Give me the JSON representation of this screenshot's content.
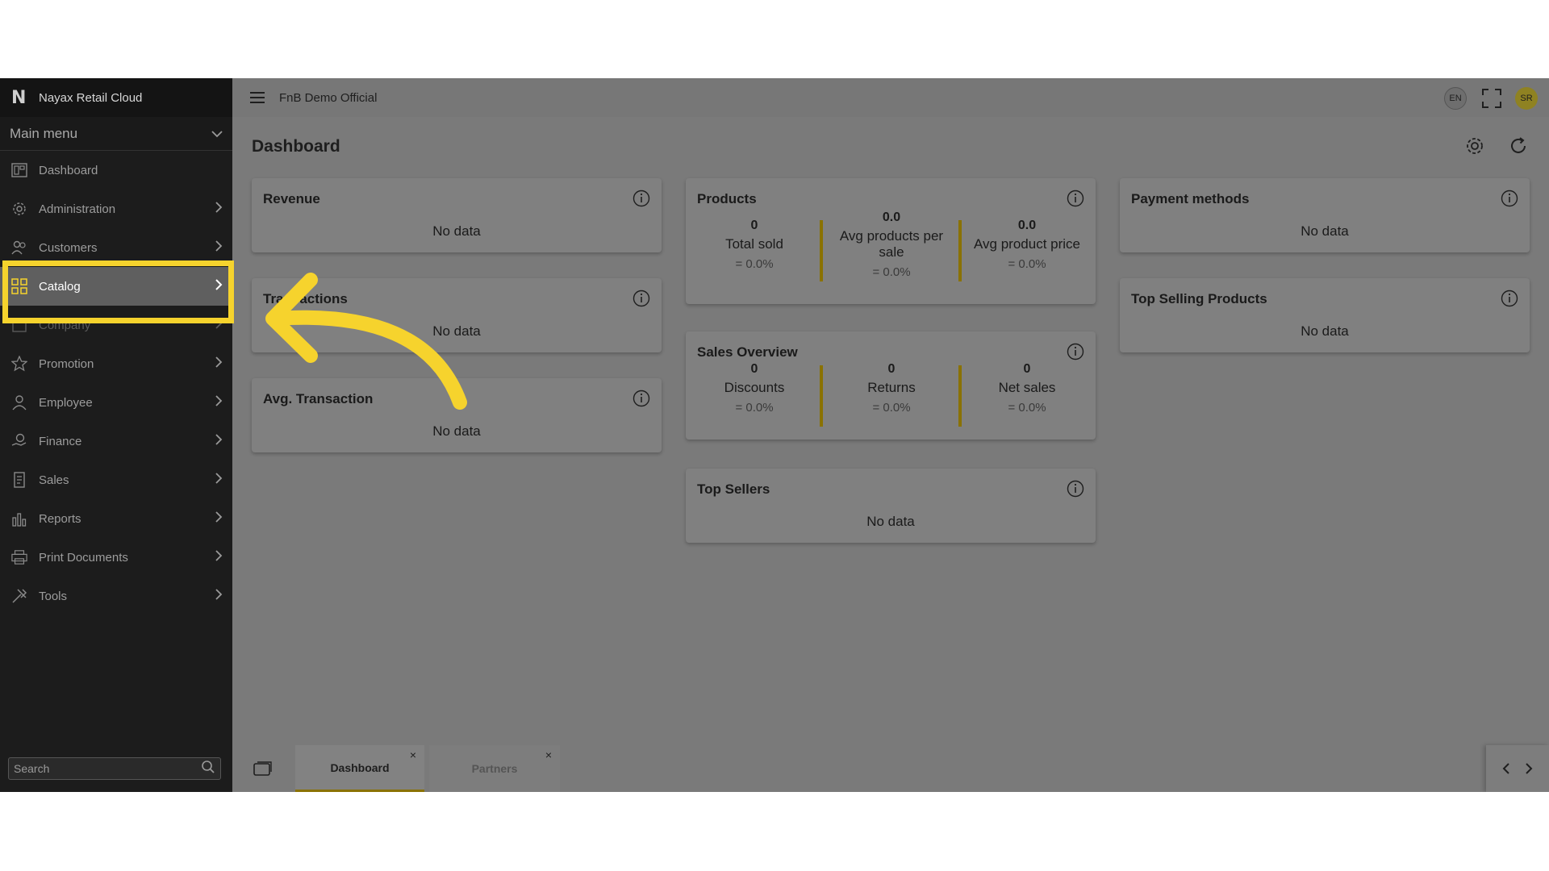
{
  "brand": {
    "name": "Nayax Retail Cloud",
    "logo_letter": "N"
  },
  "sidebar": {
    "section_label": "Main menu",
    "items": [
      {
        "label": "Dashboard",
        "icon": "dashboard-icon",
        "chevron": false
      },
      {
        "label": "Administration",
        "icon": "gear-person-icon",
        "chevron": true
      },
      {
        "label": "Customers",
        "icon": "customers-icon",
        "chevron": true
      },
      {
        "label": "Catalog",
        "icon": "grid-icon",
        "chevron": true,
        "active": true
      },
      {
        "label": "Company",
        "icon": "building-icon",
        "chevron": true
      },
      {
        "label": "Promotion",
        "icon": "star-icon",
        "chevron": true
      },
      {
        "label": "Employee",
        "icon": "employee-icon",
        "chevron": true
      },
      {
        "label": "Finance",
        "icon": "finance-icon",
        "chevron": true
      },
      {
        "label": "Sales",
        "icon": "sales-icon",
        "chevron": true
      },
      {
        "label": "Reports",
        "icon": "bar-chart-icon",
        "chevron": true
      },
      {
        "label": "Print Documents",
        "icon": "printer-icon",
        "chevron": true
      },
      {
        "label": "Tools",
        "icon": "tools-icon",
        "chevron": true
      }
    ],
    "search_placeholder": "Search"
  },
  "topbar": {
    "org_name": "FnB Demo Official",
    "language": "EN",
    "avatar_initials": "SR"
  },
  "page": {
    "title": "Dashboard"
  },
  "cards": {
    "revenue": {
      "title": "Revenue",
      "empty": "No data"
    },
    "transactions": {
      "title": "Transactions",
      "empty": "No data"
    },
    "avg_transaction": {
      "title": "Avg. Transaction",
      "empty": "No data"
    },
    "products": {
      "title": "Products",
      "metrics": [
        {
          "value": "0",
          "label": "Total sold",
          "change": "= 0.0%"
        },
        {
          "value": "0.0",
          "label": "Avg products per sale",
          "change": "= 0.0%"
        },
        {
          "value": "0.0",
          "label": "Avg product price",
          "change": "= 0.0%"
        }
      ]
    },
    "sales_overview": {
      "title": "Sales Overview",
      "metrics": [
        {
          "value": "0",
          "label": "Discounts",
          "change": "= 0.0%"
        },
        {
          "value": "0",
          "label": "Returns",
          "change": "= 0.0%"
        },
        {
          "value": "0",
          "label": "Net sales",
          "change": "= 0.0%"
        }
      ]
    },
    "top_sellers": {
      "title": "Top Sellers",
      "empty": "No data"
    },
    "payment_methods": {
      "title": "Payment methods",
      "empty": "No data"
    },
    "top_selling_products": {
      "title": "Top Selling Products",
      "empty": "No data"
    }
  },
  "tabs": [
    {
      "label": "Dashboard",
      "active": true,
      "close": "×"
    },
    {
      "label": "Partners",
      "active": false,
      "close": "×"
    }
  ],
  "colors": {
    "accent": "#f6d32d",
    "separator": "#8a7200",
    "sidebar_bg": "#1c1c1c"
  }
}
